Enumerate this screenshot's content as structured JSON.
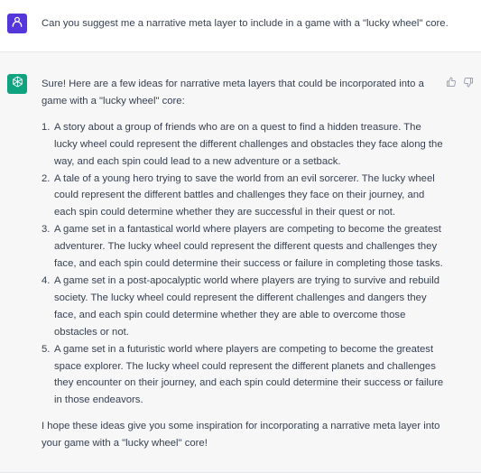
{
  "user_message": {
    "avatar_icon": "user-icon",
    "avatar_color": "#5436da",
    "text": "Can you suggest me a narrative meta layer to include in a game with a \"lucky wheel\" core."
  },
  "assistant_message": {
    "avatar_icon": "openai-logo-icon",
    "avatar_color": "#10a37f",
    "intro": "Sure! Here are a few ideas for narrative meta layers that could be incorporated into a game with a \"lucky wheel\" core:",
    "ideas": [
      {
        "number": "1.",
        "text": "A story about a group of friends who are on a quest to find a hidden treasure. The lucky wheel could represent the different challenges and obstacles they face along the way, and each spin could lead to a new adventure or a setback."
      },
      {
        "number": "2.",
        "text": "A tale of a young hero trying to save the world from an evil sorcerer. The lucky wheel could represent the different battles and challenges they face on their journey, and each spin could determine whether they are successful in their quest or not."
      },
      {
        "number": "3.",
        "text": "A game set in a fantastical world where players are competing to become the greatest adventurer. The lucky wheel could represent the different quests and challenges they face, and each spin could determine their success or failure in completing those tasks."
      },
      {
        "number": "4.",
        "text": "A game set in a post-apocalyptic world where players are trying to survive and rebuild society. The lucky wheel could represent the different challenges and dangers they face, and each spin could determine whether they are able to overcome those obstacles or not."
      },
      {
        "number": "5.",
        "text": "A game set in a futuristic world where players are competing to become the greatest space explorer. The lucky wheel could represent the different planets and challenges they encounter on their journey, and each spin could determine their success or failure in those endeavors."
      }
    ],
    "outro": "I hope these ideas give you some inspiration for incorporating a narrative meta layer into your game with a \"lucky wheel\" core!",
    "feedback": {
      "thumbs_up_icon": "thumbs-up-icon",
      "thumbs_down_icon": "thumbs-down-icon"
    }
  }
}
